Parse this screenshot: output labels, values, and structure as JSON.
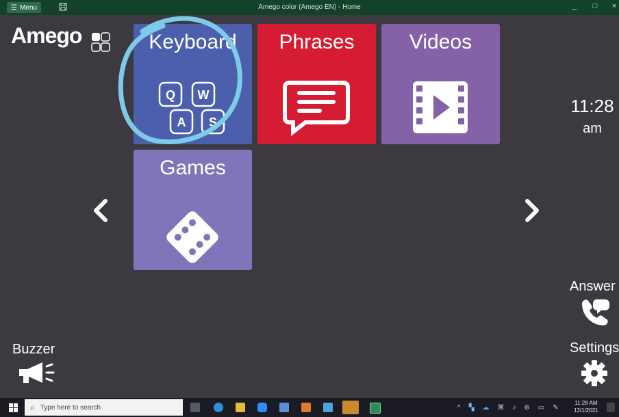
{
  "titlebar": {
    "menu_label": "Menu",
    "title": "Amego color (Amego EN) - Home",
    "minimize": "_",
    "maximize": "□",
    "close": "×"
  },
  "logo": {
    "text": "Amego"
  },
  "tiles": [
    {
      "label": "Keyboard",
      "color": "#4b5fac",
      "icon": "keyboard-keys-icon",
      "keys": [
        "Q",
        "W",
        "A",
        "S"
      ]
    },
    {
      "label": "Phrases",
      "color": "#d61c33",
      "icon": "speech-bubble-icon"
    },
    {
      "label": "Videos",
      "color": "#8561a8",
      "icon": "film-play-icon"
    },
    {
      "label": "Games",
      "color": "#7e76b8",
      "icon": "dice-icon"
    }
  ],
  "nav": {
    "prev_icon": "chevron-left-icon",
    "next_icon": "chevron-right-icon"
  },
  "clock": {
    "time": "11:28",
    "ampm": "am"
  },
  "answer": {
    "label": "Answer",
    "icon": "phone-answer-icon"
  },
  "settings": {
    "label": "Settings",
    "icon": "gear-icon"
  },
  "buzzer": {
    "label": "Buzzer",
    "icon": "megaphone-icon"
  },
  "taskbar": {
    "search_placeholder": "Type here to search",
    "time": "11:28 AM",
    "date": "12/1/2021"
  },
  "colors": {
    "background": "#3c3a40",
    "titlebar": "#14412a",
    "highlight_circle": "#7ecbe8"
  }
}
